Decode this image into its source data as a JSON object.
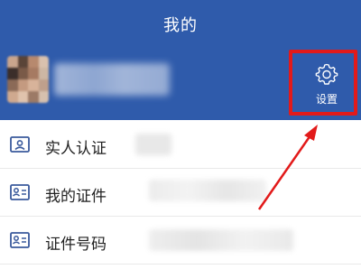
{
  "header": {
    "title": "我的",
    "settings_label": "设置",
    "background_color": "#2f5bab"
  },
  "profile": {
    "avatar": "blurred-avatar",
    "name": ""
  },
  "menu": {
    "items": [
      {
        "label": "实人认证",
        "icon": "id-card-icon"
      },
      {
        "label": "我的证件",
        "icon": "id-card-icon"
      },
      {
        "label": "证件号码",
        "icon": "id-card-icon"
      }
    ]
  },
  "annotation": {
    "highlight_color": "#e21a1a",
    "target": "settings-button"
  },
  "icons": {
    "settings": "gear-icon"
  }
}
